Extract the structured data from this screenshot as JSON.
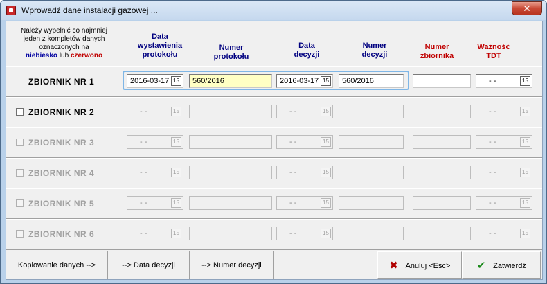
{
  "window": {
    "title": "Wprowadź dane instalacji gazowej ...",
    "close_glyph": "✕"
  },
  "note": {
    "line1": "Należy wypełnić co najmniej",
    "line2": "jeden z kompletów danych",
    "line3": "oznaczonych na",
    "blue_word": "niebiesko",
    "or_word": "lub",
    "red_word": "czerwono"
  },
  "headers": {
    "data_wystawienia": [
      "Data",
      "wystawienia",
      "protokołu"
    ],
    "numer_protokolu": [
      "Numer",
      "protokołu"
    ],
    "data_decyzji": [
      "Data",
      "decyzji"
    ],
    "numer_decyzji": [
      "Numer",
      "decyzji"
    ],
    "numer_zbiornika": [
      "Numer",
      "zbiornika"
    ],
    "waznosc_tdt": [
      "Ważność",
      "TDT"
    ]
  },
  "rows": [
    {
      "label": "ZBIORNIK NR 1",
      "enabled": true,
      "active": true,
      "has_checkbox": false,
      "data_wystawienia": "2016-03-17",
      "numer_protokolu": "560/2016",
      "data_decyzji": "2016-03-17",
      "numer_decyzji": "560/2016",
      "numer_zbiornika": "",
      "waznosc_tdt": " - -"
    },
    {
      "label": "ZBIORNIK NR 2",
      "enabled": true,
      "active": false,
      "has_checkbox": true,
      "data_wystawienia": " - -",
      "numer_protokolu": "",
      "data_decyzji": " - -",
      "numer_decyzji": "",
      "numer_zbiornika": "",
      "waznosc_tdt": " - -"
    },
    {
      "label": "ZBIORNIK NR 3",
      "enabled": false,
      "active": false,
      "has_checkbox": true,
      "data_wystawienia": " - -",
      "numer_protokolu": "",
      "data_decyzji": " - -",
      "numer_decyzji": "",
      "numer_zbiornika": "",
      "waznosc_tdt": " - -"
    },
    {
      "label": "ZBIORNIK NR 4",
      "enabled": false,
      "active": false,
      "has_checkbox": true,
      "data_wystawienia": " - -",
      "numer_protokolu": "",
      "data_decyzji": " - -",
      "numer_decyzji": "",
      "numer_zbiornika": "",
      "waznosc_tdt": " - -"
    },
    {
      "label": "ZBIORNIK NR 5",
      "enabled": false,
      "active": false,
      "has_checkbox": true,
      "data_wystawienia": " - -",
      "numer_protokolu": "",
      "data_decyzji": " - -",
      "numer_decyzji": "",
      "numer_zbiornika": "",
      "waznosc_tdt": " - -"
    },
    {
      "label": "ZBIORNIK NR 6",
      "enabled": false,
      "active": false,
      "has_checkbox": true,
      "data_wystawienia": " - -",
      "numer_protokolu": "",
      "data_decyzji": " - -",
      "numer_decyzji": "",
      "numer_zbiornika": "",
      "waznosc_tdt": " - -"
    }
  ],
  "calendar_glyph": "15",
  "footer": {
    "copy_label": "Kopiowanie danych -->",
    "to_data_decyzji": "--> Data decyzji",
    "to_numer_decyzji": "--> Numer decyzji",
    "cancel": "Anuluj <Esc>",
    "confirm": "Zatwierdź",
    "cancel_icon": "x-icon",
    "confirm_icon": "checkmark-icon"
  },
  "colors": {
    "blue": "#000080",
    "red": "#c00000",
    "active_frame": "#7fb6e6",
    "field_highlight": "#ffffc4"
  }
}
